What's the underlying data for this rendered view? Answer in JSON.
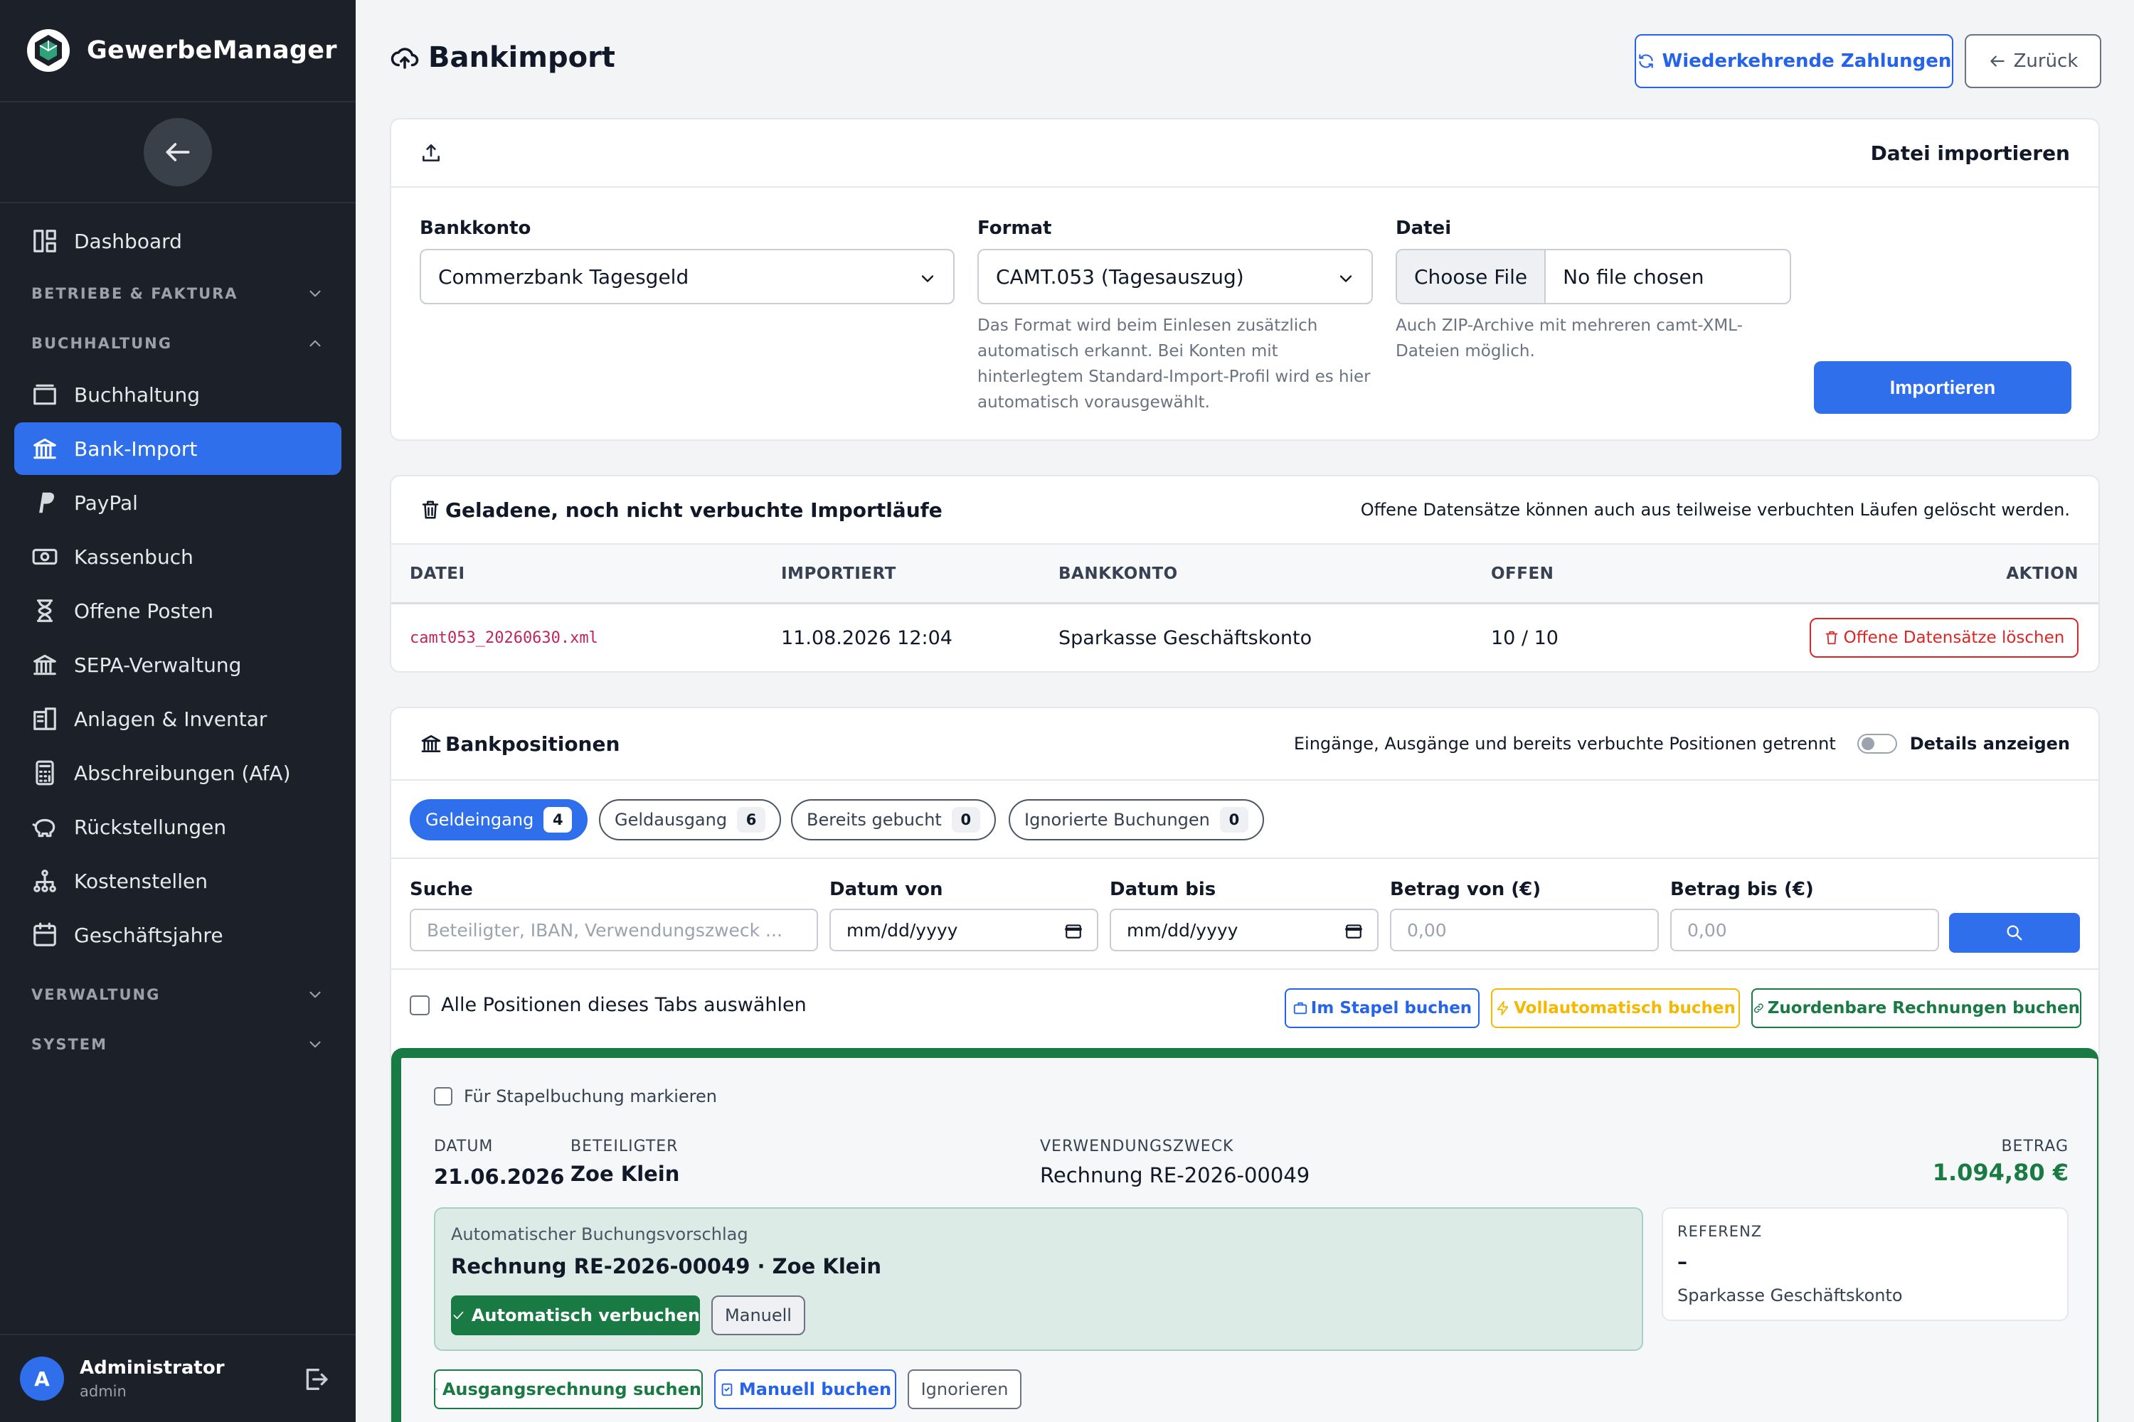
{
  "app": {
    "name": "GewerbeManager"
  },
  "sidebar": {
    "items_top": [
      {
        "label": "Dashboard",
        "icon": "dashboard-icon"
      }
    ],
    "sections": [
      {
        "label": "BETRIEBE & FAKTURA",
        "expanded": false
      },
      {
        "label": "BUCHHALTUNG",
        "expanded": true
      },
      {
        "label": "VERWALTUNG",
        "expanded": false
      },
      {
        "label": "SYSTEM",
        "expanded": false
      }
    ],
    "items": [
      {
        "label": "Buchhaltung",
        "icon": "folder-icon"
      },
      {
        "label": "Bank-Import",
        "icon": "bank-icon",
        "active": true
      },
      {
        "label": "PayPal",
        "icon": "paypal-icon"
      },
      {
        "label": "Kassenbuch",
        "icon": "cash-icon"
      },
      {
        "label": "Offene Posten",
        "icon": "hourglass-icon"
      },
      {
        "label": "SEPA-Verwaltung",
        "icon": "bank-icon"
      },
      {
        "label": "Anlagen & Inventar",
        "icon": "inventory-icon"
      },
      {
        "label": "Abschreibungen (AfA)",
        "icon": "calculator-icon"
      },
      {
        "label": "Rückstellungen",
        "icon": "piggy-bank-icon"
      },
      {
        "label": "Kostenstellen",
        "icon": "hierarchy-icon"
      },
      {
        "label": "Geschäftsjahre",
        "icon": "calendar-icon"
      }
    ],
    "user": {
      "initial": "A",
      "name": "Administrator",
      "role": "admin"
    }
  },
  "header": {
    "title": "Bankimport",
    "recurring_label": "Wiederkehrende Zahlungen",
    "back_label": "Zurück"
  },
  "import": {
    "title": "Datei importieren",
    "bank_label": "Bankkonto",
    "bank_value": "Commerzbank Tagesgeld",
    "format_label": "Format",
    "format_value": "CAMT.053 (Tagesauszug)",
    "format_help_1": "Das Format wird beim Einlesen zusätzlich",
    "format_help_2": "automatisch erkannt. Bei Konten mit",
    "format_help_3": "hinterlegtem Standard-Import-Profil wird es hier",
    "format_help_4": "automatisch vorausgewählt.",
    "file_label": "Datei",
    "choose_label": "Choose File",
    "no_file": "No file chosen",
    "file_help_1": "Auch ZIP-Archive mit mehreren camt-XML-",
    "file_help_2": "Dateien möglich.",
    "submit_label": "Importieren"
  },
  "runs": {
    "title": "Geladene, noch nicht verbuchte Importläufe",
    "note": "Offene Datensätze können auch aus teilweise verbuchten Läufen gelöscht werden.",
    "columns": [
      "DATEI",
      "IMPORTIERT",
      "BANKKONTO",
      "OFFEN",
      "AKTION"
    ],
    "rows": [
      {
        "file": "camt053_20260630.xml",
        "imported": "11.08.2026 12:04",
        "account": "Sparkasse Geschäftskonto",
        "open": "10 / 10",
        "action": "Offene Datensätze löschen"
      }
    ]
  },
  "positions": {
    "title": "Bankpositionen",
    "note": "Eingänge, Ausgänge und bereits verbuchte Positionen getrennt",
    "details_label": "Details anzeigen",
    "tabs": [
      {
        "label": "Geldeingang",
        "count": "4"
      },
      {
        "label": "Geldausgang",
        "count": "6"
      },
      {
        "label": "Bereits gebucht",
        "count": "0"
      },
      {
        "label": "Ignorierte Buchungen",
        "count": "0"
      }
    ],
    "filters": {
      "search_label": "Suche",
      "search_placeholder": "Beteiligter, IBAN, Verwendungszweck ...",
      "date_from_label": "Datum von",
      "date_from_value": "mm/dd/yyyy",
      "date_to_label": "Datum bis",
      "date_to_value": "mm/dd/yyyy",
      "amount_from_label": "Betrag von (€)",
      "amount_from_placeholder": "0,00",
      "amount_to_label": "Betrag bis (€)",
      "amount_to_placeholder": "0,00"
    },
    "select_all_label": "Alle Positionen dieses Tabs auswählen",
    "bulk": {
      "batch_label": "Im Stapel buchen",
      "auto_label": "Vollautomatisch buchen",
      "assign_label": "Zuordenbare Rechnungen buchen"
    },
    "entry": {
      "mark_label": "Für Stapelbuchung markieren",
      "date_label": "DATUM",
      "date": "21.06.2026",
      "party_label": "BETEILIGTER",
      "party": "Zoe Klein",
      "purpose_label": "VERWENDUNGSZWECK",
      "purpose": "Rechnung RE-2026-00049",
      "amount_label": "BETRAG",
      "amount": "1.094,80 €",
      "suggestion_title": "Automatischer Buchungsvorschlag",
      "suggestion": "Rechnung RE-2026-00049 · Zoe Klein",
      "auto_label": "Automatisch verbuchen",
      "manual_label": "Manuell",
      "ref_label": "REFERENZ",
      "ref_value": "–",
      "ref_account": "Sparkasse Geschäftskonto",
      "search_invoice_label": "Ausgangsrechnung suchen",
      "book_manual_label": "Manuell buchen",
      "ignore_label": "Ignorieren"
    }
  },
  "colors": {
    "primary": "#2f6fec",
    "sidebar": "#1c2129",
    "success": "#1a7a44",
    "danger": "#dc2626",
    "warning": "#f5b800"
  }
}
